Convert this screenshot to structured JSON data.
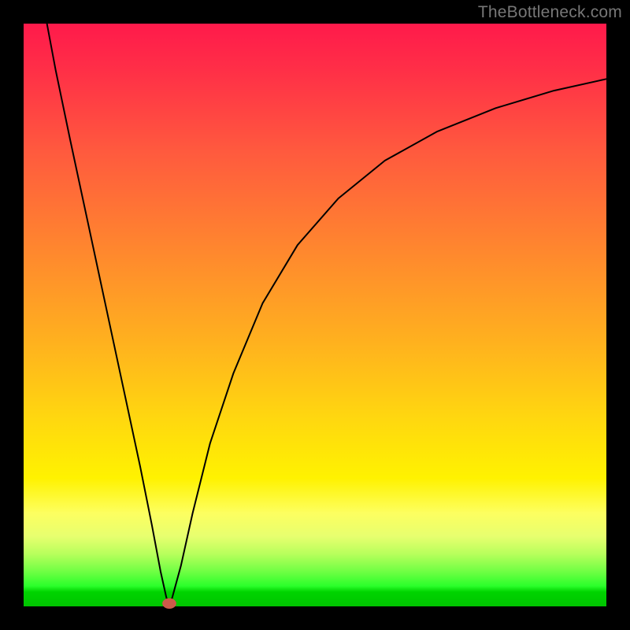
{
  "watermark": "TheBottleneck.com",
  "chart_data": {
    "type": "line",
    "title": "",
    "xlabel": "",
    "ylabel": "",
    "xlim": [
      0,
      100
    ],
    "ylim": [
      0,
      100
    ],
    "grid": false,
    "axes_visible": false,
    "background": "rainbow-gradient-vertical",
    "gradient_stops": [
      {
        "pos": 0.0,
        "color": "#ff1a4b"
      },
      {
        "pos": 0.22,
        "color": "#ff5a3e"
      },
      {
        "pos": 0.55,
        "color": "#ffb21e"
      },
      {
        "pos": 0.78,
        "color": "#fff200"
      },
      {
        "pos": 0.94,
        "color": "#70ff44"
      },
      {
        "pos": 1.0,
        "color": "#00c400"
      }
    ],
    "series": [
      {
        "name": "bottleneck-curve",
        "color": "#000000",
        "stroke_width": 2,
        "points": [
          {
            "x": 4.0,
            "y": 100.0
          },
          {
            "x": 5.5,
            "y": 92.0
          },
          {
            "x": 8.0,
            "y": 80.0
          },
          {
            "x": 11.0,
            "y": 66.0
          },
          {
            "x": 14.0,
            "y": 52.0
          },
          {
            "x": 17.0,
            "y": 38.0
          },
          {
            "x": 20.0,
            "y": 24.0
          },
          {
            "x": 22.0,
            "y": 14.0
          },
          {
            "x": 23.5,
            "y": 6.0
          },
          {
            "x": 24.5,
            "y": 1.5
          },
          {
            "x": 25.0,
            "y": 0.5
          },
          {
            "x": 25.5,
            "y": 1.5
          },
          {
            "x": 27.0,
            "y": 7.0
          },
          {
            "x": 29.0,
            "y": 16.0
          },
          {
            "x": 32.0,
            "y": 28.0
          },
          {
            "x": 36.0,
            "y": 40.0
          },
          {
            "x": 41.0,
            "y": 52.0
          },
          {
            "x": 47.0,
            "y": 62.0
          },
          {
            "x": 54.0,
            "y": 70.0
          },
          {
            "x": 62.0,
            "y": 76.5
          },
          {
            "x": 71.0,
            "y": 81.5
          },
          {
            "x": 81.0,
            "y": 85.5
          },
          {
            "x": 91.0,
            "y": 88.5
          },
          {
            "x": 100.0,
            "y": 90.5
          }
        ]
      }
    ],
    "markers": [
      {
        "name": "minimum-point",
        "shape": "ellipse",
        "x": 25.0,
        "y": 0.5,
        "rx": 1.2,
        "ry": 0.9,
        "fill": "#cc5a4a"
      }
    ]
  }
}
